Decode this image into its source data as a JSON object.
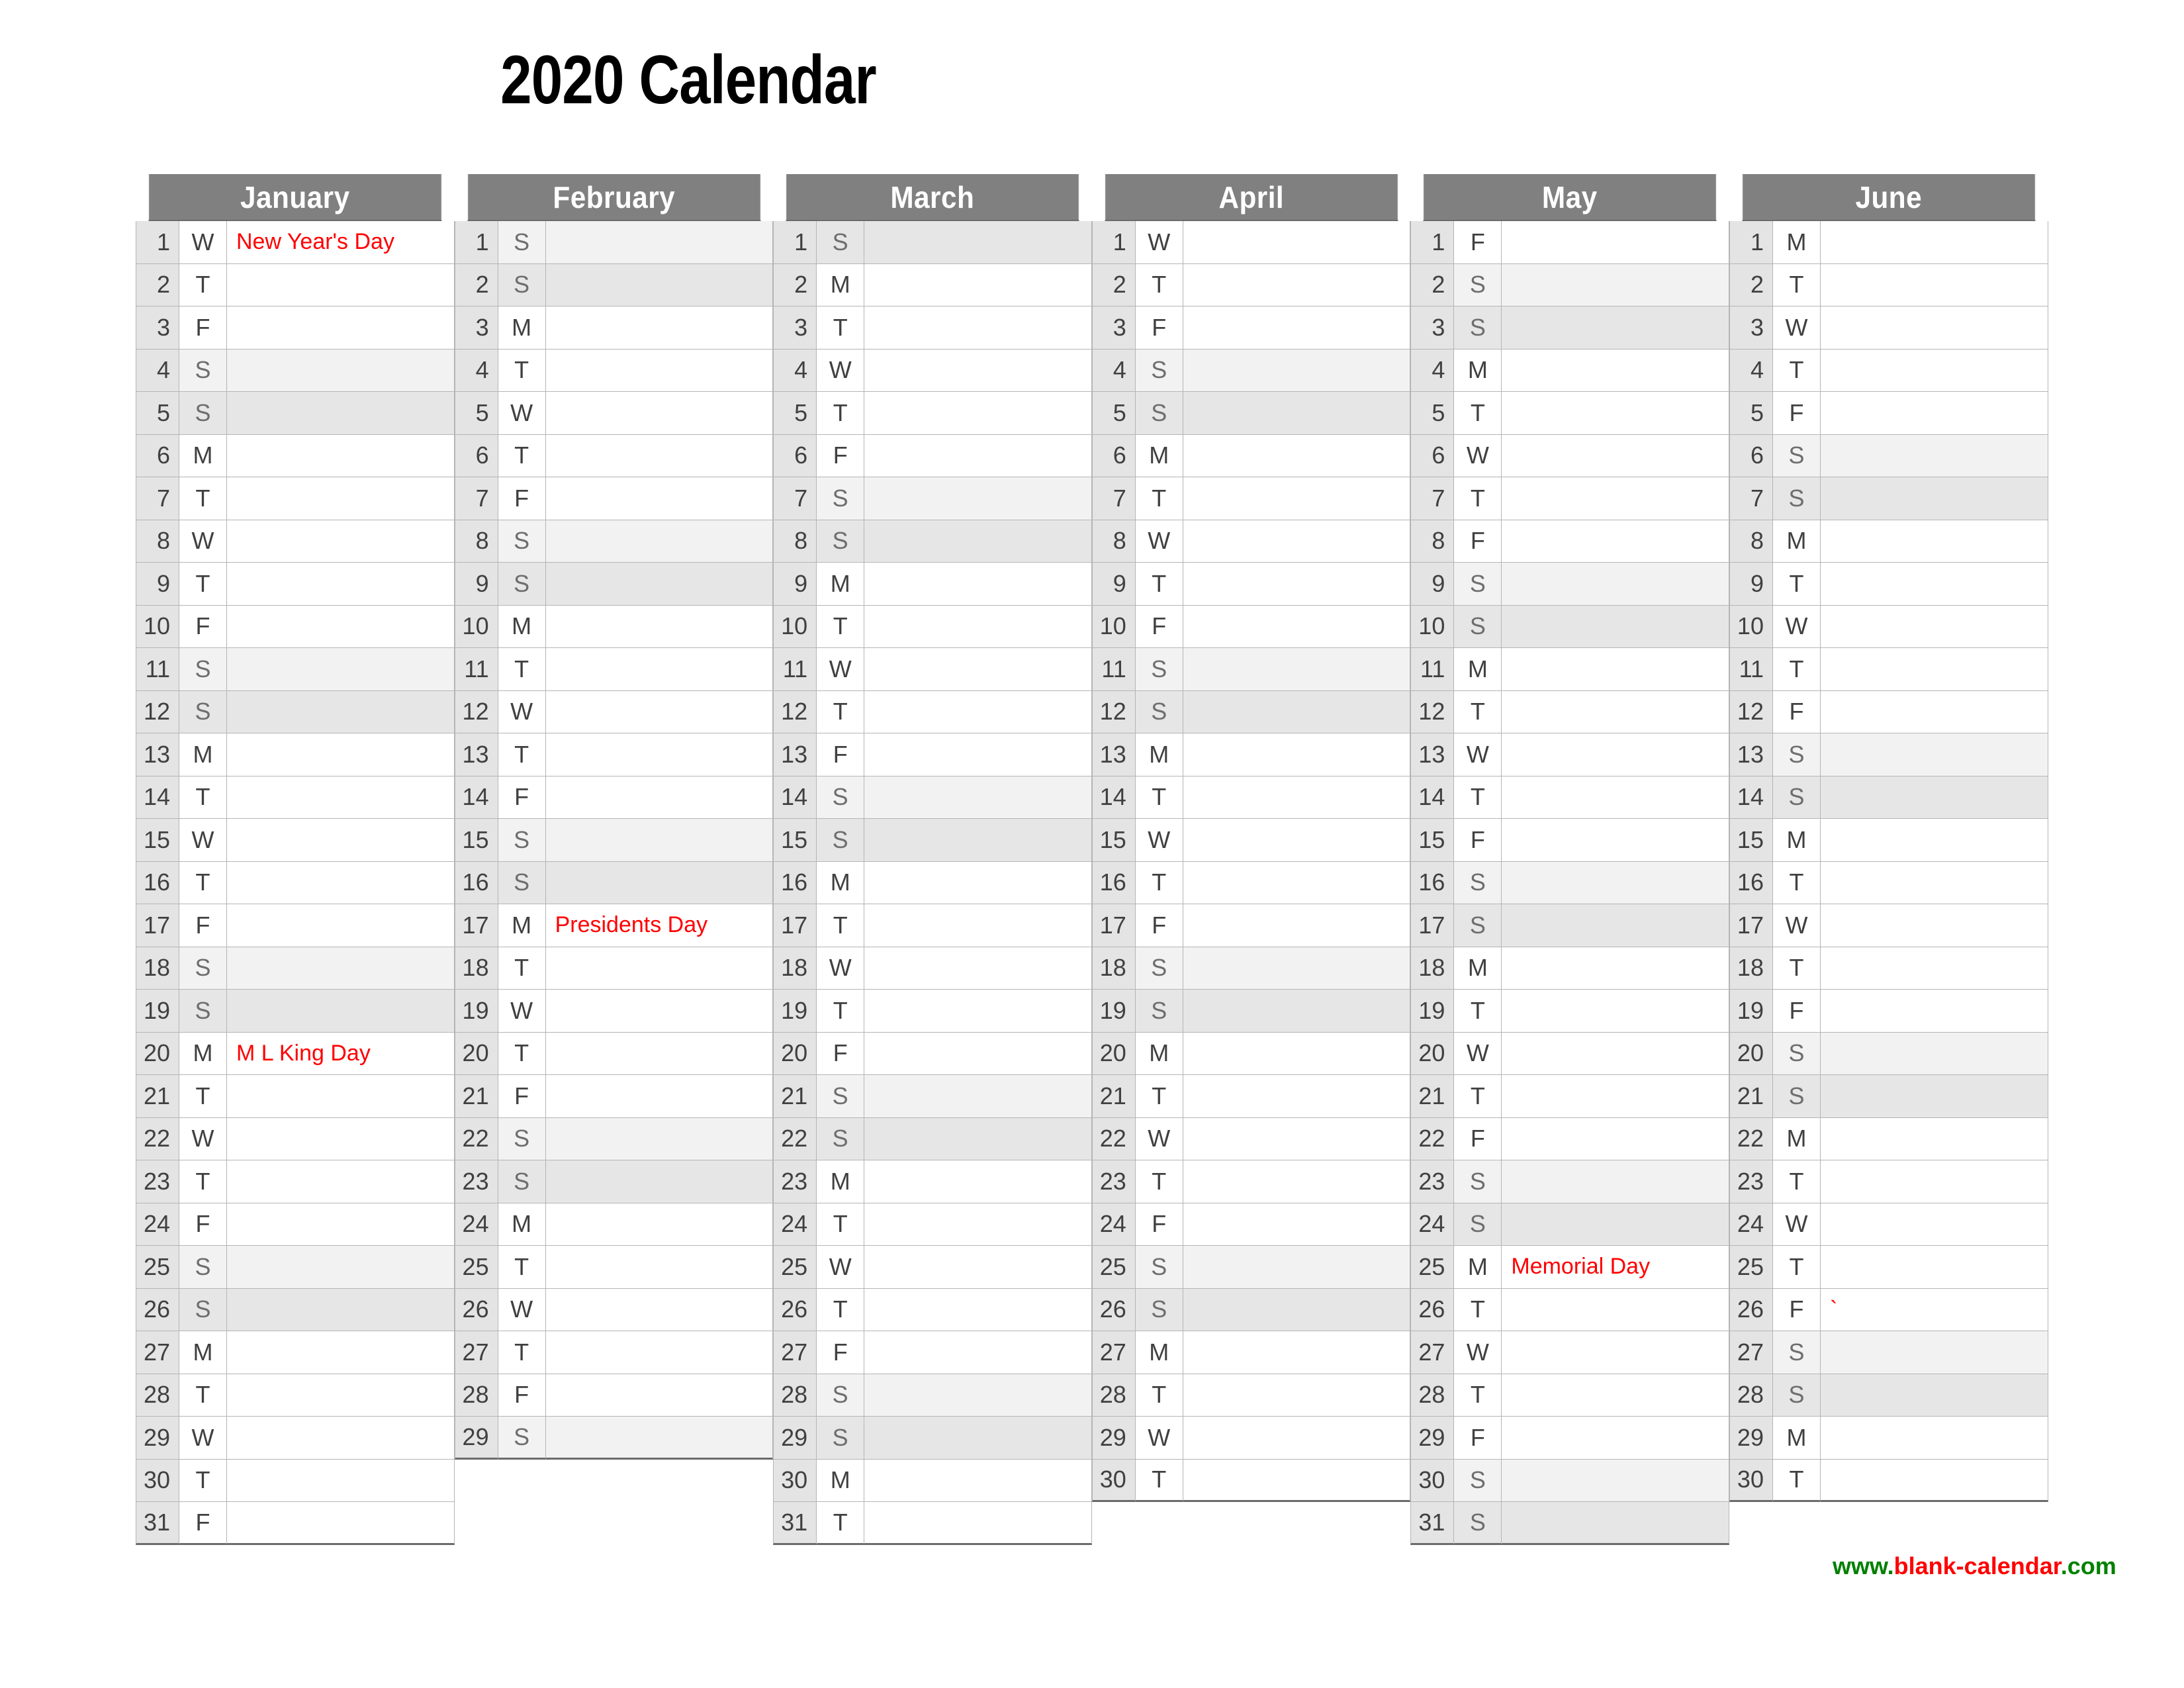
{
  "title": "2020 Calendar",
  "footer": {
    "prefix": "www.",
    "middle": "blank-calendar",
    "suffix": ".com",
    "green_color": "#008000",
    "red_color": "#ff0000"
  },
  "colors": {
    "header_bg": "#808080",
    "header_text": "#ffffff",
    "daynum_bg": "#e4e4e4",
    "saturday_bg": "#f2f2f2",
    "sunday_bg": "#e6e6e6",
    "holiday_text": "#ff0000",
    "grid_line": "#b5b5b5",
    "day_text": "#404040"
  },
  "months": [
    {
      "name": "January",
      "days": [
        {
          "n": "1",
          "dow": "W",
          "note": "New Year's Day"
        },
        {
          "n": "2",
          "dow": "T",
          "note": ""
        },
        {
          "n": "3",
          "dow": "F",
          "note": ""
        },
        {
          "n": "4",
          "dow": "S",
          "note": "",
          "weekend": "sat"
        },
        {
          "n": "5",
          "dow": "S",
          "note": "",
          "weekend": "sun"
        },
        {
          "n": "6",
          "dow": "M",
          "note": ""
        },
        {
          "n": "7",
          "dow": "T",
          "note": ""
        },
        {
          "n": "8",
          "dow": "W",
          "note": ""
        },
        {
          "n": "9",
          "dow": "T",
          "note": ""
        },
        {
          "n": "10",
          "dow": "F",
          "note": ""
        },
        {
          "n": "11",
          "dow": "S",
          "note": "",
          "weekend": "sat"
        },
        {
          "n": "12",
          "dow": "S",
          "note": "",
          "weekend": "sun"
        },
        {
          "n": "13",
          "dow": "M",
          "note": ""
        },
        {
          "n": "14",
          "dow": "T",
          "note": ""
        },
        {
          "n": "15",
          "dow": "W",
          "note": ""
        },
        {
          "n": "16",
          "dow": "T",
          "note": ""
        },
        {
          "n": "17",
          "dow": "F",
          "note": ""
        },
        {
          "n": "18",
          "dow": "S",
          "note": "",
          "weekend": "sat"
        },
        {
          "n": "19",
          "dow": "S",
          "note": "",
          "weekend": "sun"
        },
        {
          "n": "20",
          "dow": "M",
          "note": "M L King Day"
        },
        {
          "n": "21",
          "dow": "T",
          "note": ""
        },
        {
          "n": "22",
          "dow": "W",
          "note": ""
        },
        {
          "n": "23",
          "dow": "T",
          "note": ""
        },
        {
          "n": "24",
          "dow": "F",
          "note": ""
        },
        {
          "n": "25",
          "dow": "S",
          "note": "",
          "weekend": "sat"
        },
        {
          "n": "26",
          "dow": "S",
          "note": "",
          "weekend": "sun"
        },
        {
          "n": "27",
          "dow": "M",
          "note": ""
        },
        {
          "n": "28",
          "dow": "T",
          "note": ""
        },
        {
          "n": "29",
          "dow": "W",
          "note": ""
        },
        {
          "n": "30",
          "dow": "T",
          "note": ""
        },
        {
          "n": "31",
          "dow": "F",
          "note": ""
        }
      ]
    },
    {
      "name": "February",
      "days": [
        {
          "n": "1",
          "dow": "S",
          "note": "",
          "weekend": "sat"
        },
        {
          "n": "2",
          "dow": "S",
          "note": "",
          "weekend": "sun"
        },
        {
          "n": "3",
          "dow": "M",
          "note": ""
        },
        {
          "n": "4",
          "dow": "T",
          "note": ""
        },
        {
          "n": "5",
          "dow": "W",
          "note": ""
        },
        {
          "n": "6",
          "dow": "T",
          "note": ""
        },
        {
          "n": "7",
          "dow": "F",
          "note": ""
        },
        {
          "n": "8",
          "dow": "S",
          "note": "",
          "weekend": "sat"
        },
        {
          "n": "9",
          "dow": "S",
          "note": "",
          "weekend": "sun"
        },
        {
          "n": "10",
          "dow": "M",
          "note": ""
        },
        {
          "n": "11",
          "dow": "T",
          "note": ""
        },
        {
          "n": "12",
          "dow": "W",
          "note": ""
        },
        {
          "n": "13",
          "dow": "T",
          "note": ""
        },
        {
          "n": "14",
          "dow": "F",
          "note": ""
        },
        {
          "n": "15",
          "dow": "S",
          "note": "",
          "weekend": "sat"
        },
        {
          "n": "16",
          "dow": "S",
          "note": "",
          "weekend": "sun"
        },
        {
          "n": "17",
          "dow": "M",
          "note": "Presidents Day"
        },
        {
          "n": "18",
          "dow": "T",
          "note": ""
        },
        {
          "n": "19",
          "dow": "W",
          "note": ""
        },
        {
          "n": "20",
          "dow": "T",
          "note": ""
        },
        {
          "n": "21",
          "dow": "F",
          "note": ""
        },
        {
          "n": "22",
          "dow": "S",
          "note": "",
          "weekend": "sat"
        },
        {
          "n": "23",
          "dow": "S",
          "note": "",
          "weekend": "sun"
        },
        {
          "n": "24",
          "dow": "M",
          "note": ""
        },
        {
          "n": "25",
          "dow": "T",
          "note": ""
        },
        {
          "n": "26",
          "dow": "W",
          "note": ""
        },
        {
          "n": "27",
          "dow": "T",
          "note": ""
        },
        {
          "n": "28",
          "dow": "F",
          "note": ""
        },
        {
          "n": "29",
          "dow": "S",
          "note": "",
          "weekend": "sat"
        }
      ]
    },
    {
      "name": "March",
      "days": [
        {
          "n": "1",
          "dow": "S",
          "note": "",
          "weekend": "sun"
        },
        {
          "n": "2",
          "dow": "M",
          "note": ""
        },
        {
          "n": "3",
          "dow": "T",
          "note": ""
        },
        {
          "n": "4",
          "dow": "W",
          "note": ""
        },
        {
          "n": "5",
          "dow": "T",
          "note": ""
        },
        {
          "n": "6",
          "dow": "F",
          "note": ""
        },
        {
          "n": "7",
          "dow": "S",
          "note": "",
          "weekend": "sat"
        },
        {
          "n": "8",
          "dow": "S",
          "note": "",
          "weekend": "sun"
        },
        {
          "n": "9",
          "dow": "M",
          "note": ""
        },
        {
          "n": "10",
          "dow": "T",
          "note": ""
        },
        {
          "n": "11",
          "dow": "W",
          "note": ""
        },
        {
          "n": "12",
          "dow": "T",
          "note": ""
        },
        {
          "n": "13",
          "dow": "F",
          "note": ""
        },
        {
          "n": "14",
          "dow": "S",
          "note": "",
          "weekend": "sat"
        },
        {
          "n": "15",
          "dow": "S",
          "note": "",
          "weekend": "sun"
        },
        {
          "n": "16",
          "dow": "M",
          "note": ""
        },
        {
          "n": "17",
          "dow": "T",
          "note": ""
        },
        {
          "n": "18",
          "dow": "W",
          "note": ""
        },
        {
          "n": "19",
          "dow": "T",
          "note": ""
        },
        {
          "n": "20",
          "dow": "F",
          "note": ""
        },
        {
          "n": "21",
          "dow": "S",
          "note": "",
          "weekend": "sat"
        },
        {
          "n": "22",
          "dow": "S",
          "note": "",
          "weekend": "sun"
        },
        {
          "n": "23",
          "dow": "M",
          "note": ""
        },
        {
          "n": "24",
          "dow": "T",
          "note": ""
        },
        {
          "n": "25",
          "dow": "W",
          "note": ""
        },
        {
          "n": "26",
          "dow": "T",
          "note": ""
        },
        {
          "n": "27",
          "dow": "F",
          "note": ""
        },
        {
          "n": "28",
          "dow": "S",
          "note": "",
          "weekend": "sat"
        },
        {
          "n": "29",
          "dow": "S",
          "note": "",
          "weekend": "sun"
        },
        {
          "n": "30",
          "dow": "M",
          "note": ""
        },
        {
          "n": "31",
          "dow": "T",
          "note": ""
        }
      ]
    },
    {
      "name": "April",
      "days": [
        {
          "n": "1",
          "dow": "W",
          "note": ""
        },
        {
          "n": "2",
          "dow": "T",
          "note": ""
        },
        {
          "n": "3",
          "dow": "F",
          "note": ""
        },
        {
          "n": "4",
          "dow": "S",
          "note": "",
          "weekend": "sat"
        },
        {
          "n": "5",
          "dow": "S",
          "note": "",
          "weekend": "sun"
        },
        {
          "n": "6",
          "dow": "M",
          "note": ""
        },
        {
          "n": "7",
          "dow": "T",
          "note": ""
        },
        {
          "n": "8",
          "dow": "W",
          "note": ""
        },
        {
          "n": "9",
          "dow": "T",
          "note": ""
        },
        {
          "n": "10",
          "dow": "F",
          "note": ""
        },
        {
          "n": "11",
          "dow": "S",
          "note": "",
          "weekend": "sat"
        },
        {
          "n": "12",
          "dow": "S",
          "note": "",
          "weekend": "sun"
        },
        {
          "n": "13",
          "dow": "M",
          "note": ""
        },
        {
          "n": "14",
          "dow": "T",
          "note": ""
        },
        {
          "n": "15",
          "dow": "W",
          "note": ""
        },
        {
          "n": "16",
          "dow": "T",
          "note": ""
        },
        {
          "n": "17",
          "dow": "F",
          "note": ""
        },
        {
          "n": "18",
          "dow": "S",
          "note": "",
          "weekend": "sat"
        },
        {
          "n": "19",
          "dow": "S",
          "note": "",
          "weekend": "sun"
        },
        {
          "n": "20",
          "dow": "M",
          "note": ""
        },
        {
          "n": "21",
          "dow": "T",
          "note": ""
        },
        {
          "n": "22",
          "dow": "W",
          "note": ""
        },
        {
          "n": "23",
          "dow": "T",
          "note": ""
        },
        {
          "n": "24",
          "dow": "F",
          "note": ""
        },
        {
          "n": "25",
          "dow": "S",
          "note": "",
          "weekend": "sat"
        },
        {
          "n": "26",
          "dow": "S",
          "note": "",
          "weekend": "sun"
        },
        {
          "n": "27",
          "dow": "M",
          "note": ""
        },
        {
          "n": "28",
          "dow": "T",
          "note": ""
        },
        {
          "n": "29",
          "dow": "W",
          "note": ""
        },
        {
          "n": "30",
          "dow": "T",
          "note": ""
        }
      ]
    },
    {
      "name": "May",
      "days": [
        {
          "n": "1",
          "dow": "F",
          "note": ""
        },
        {
          "n": "2",
          "dow": "S",
          "note": "",
          "weekend": "sat"
        },
        {
          "n": "3",
          "dow": "S",
          "note": "",
          "weekend": "sun"
        },
        {
          "n": "4",
          "dow": "M",
          "note": ""
        },
        {
          "n": "5",
          "dow": "T",
          "note": ""
        },
        {
          "n": "6",
          "dow": "W",
          "note": ""
        },
        {
          "n": "7",
          "dow": "T",
          "note": ""
        },
        {
          "n": "8",
          "dow": "F",
          "note": ""
        },
        {
          "n": "9",
          "dow": "S",
          "note": "",
          "weekend": "sat"
        },
        {
          "n": "10",
          "dow": "S",
          "note": "",
          "weekend": "sun"
        },
        {
          "n": "11",
          "dow": "M",
          "note": ""
        },
        {
          "n": "12",
          "dow": "T",
          "note": ""
        },
        {
          "n": "13",
          "dow": "W",
          "note": ""
        },
        {
          "n": "14",
          "dow": "T",
          "note": ""
        },
        {
          "n": "15",
          "dow": "F",
          "note": ""
        },
        {
          "n": "16",
          "dow": "S",
          "note": "",
          "weekend": "sat"
        },
        {
          "n": "17",
          "dow": "S",
          "note": "",
          "weekend": "sun"
        },
        {
          "n": "18",
          "dow": "M",
          "note": ""
        },
        {
          "n": "19",
          "dow": "T",
          "note": ""
        },
        {
          "n": "20",
          "dow": "W",
          "note": ""
        },
        {
          "n": "21",
          "dow": "T",
          "note": ""
        },
        {
          "n": "22",
          "dow": "F",
          "note": ""
        },
        {
          "n": "23",
          "dow": "S",
          "note": "",
          "weekend": "sat"
        },
        {
          "n": "24",
          "dow": "S",
          "note": "",
          "weekend": "sun"
        },
        {
          "n": "25",
          "dow": "M",
          "note": "Memorial Day"
        },
        {
          "n": "26",
          "dow": "T",
          "note": ""
        },
        {
          "n": "27",
          "dow": "W",
          "note": ""
        },
        {
          "n": "28",
          "dow": "T",
          "note": ""
        },
        {
          "n": "29",
          "dow": "F",
          "note": ""
        },
        {
          "n": "30",
          "dow": "S",
          "note": "",
          "weekend": "sat"
        },
        {
          "n": "31",
          "dow": "S",
          "note": "",
          "weekend": "sun"
        }
      ]
    },
    {
      "name": "June",
      "days": [
        {
          "n": "1",
          "dow": "M",
          "note": ""
        },
        {
          "n": "2",
          "dow": "T",
          "note": ""
        },
        {
          "n": "3",
          "dow": "W",
          "note": ""
        },
        {
          "n": "4",
          "dow": "T",
          "note": ""
        },
        {
          "n": "5",
          "dow": "F",
          "note": ""
        },
        {
          "n": "6",
          "dow": "S",
          "note": "",
          "weekend": "sat"
        },
        {
          "n": "7",
          "dow": "S",
          "note": "",
          "weekend": "sun"
        },
        {
          "n": "8",
          "dow": "M",
          "note": ""
        },
        {
          "n": "9",
          "dow": "T",
          "note": ""
        },
        {
          "n": "10",
          "dow": "W",
          "note": ""
        },
        {
          "n": "11",
          "dow": "T",
          "note": ""
        },
        {
          "n": "12",
          "dow": "F",
          "note": ""
        },
        {
          "n": "13",
          "dow": "S",
          "note": "",
          "weekend": "sat"
        },
        {
          "n": "14",
          "dow": "S",
          "note": "",
          "weekend": "sun"
        },
        {
          "n": "15",
          "dow": "M",
          "note": ""
        },
        {
          "n": "16",
          "dow": "T",
          "note": ""
        },
        {
          "n": "17",
          "dow": "W",
          "note": ""
        },
        {
          "n": "18",
          "dow": "T",
          "note": ""
        },
        {
          "n": "19",
          "dow": "F",
          "note": ""
        },
        {
          "n": "20",
          "dow": "S",
          "note": "",
          "weekend": "sat"
        },
        {
          "n": "21",
          "dow": "S",
          "note": "",
          "weekend": "sun"
        },
        {
          "n": "22",
          "dow": "M",
          "note": ""
        },
        {
          "n": "23",
          "dow": "T",
          "note": ""
        },
        {
          "n": "24",
          "dow": "W",
          "note": ""
        },
        {
          "n": "25",
          "dow": "T",
          "note": ""
        },
        {
          "n": "26",
          "dow": "F",
          "note": "`"
        },
        {
          "n": "27",
          "dow": "S",
          "note": "",
          "weekend": "sat"
        },
        {
          "n": "28",
          "dow": "S",
          "note": "",
          "weekend": "sun"
        },
        {
          "n": "29",
          "dow": "M",
          "note": ""
        },
        {
          "n": "30",
          "dow": "T",
          "note": ""
        }
      ]
    }
  ]
}
